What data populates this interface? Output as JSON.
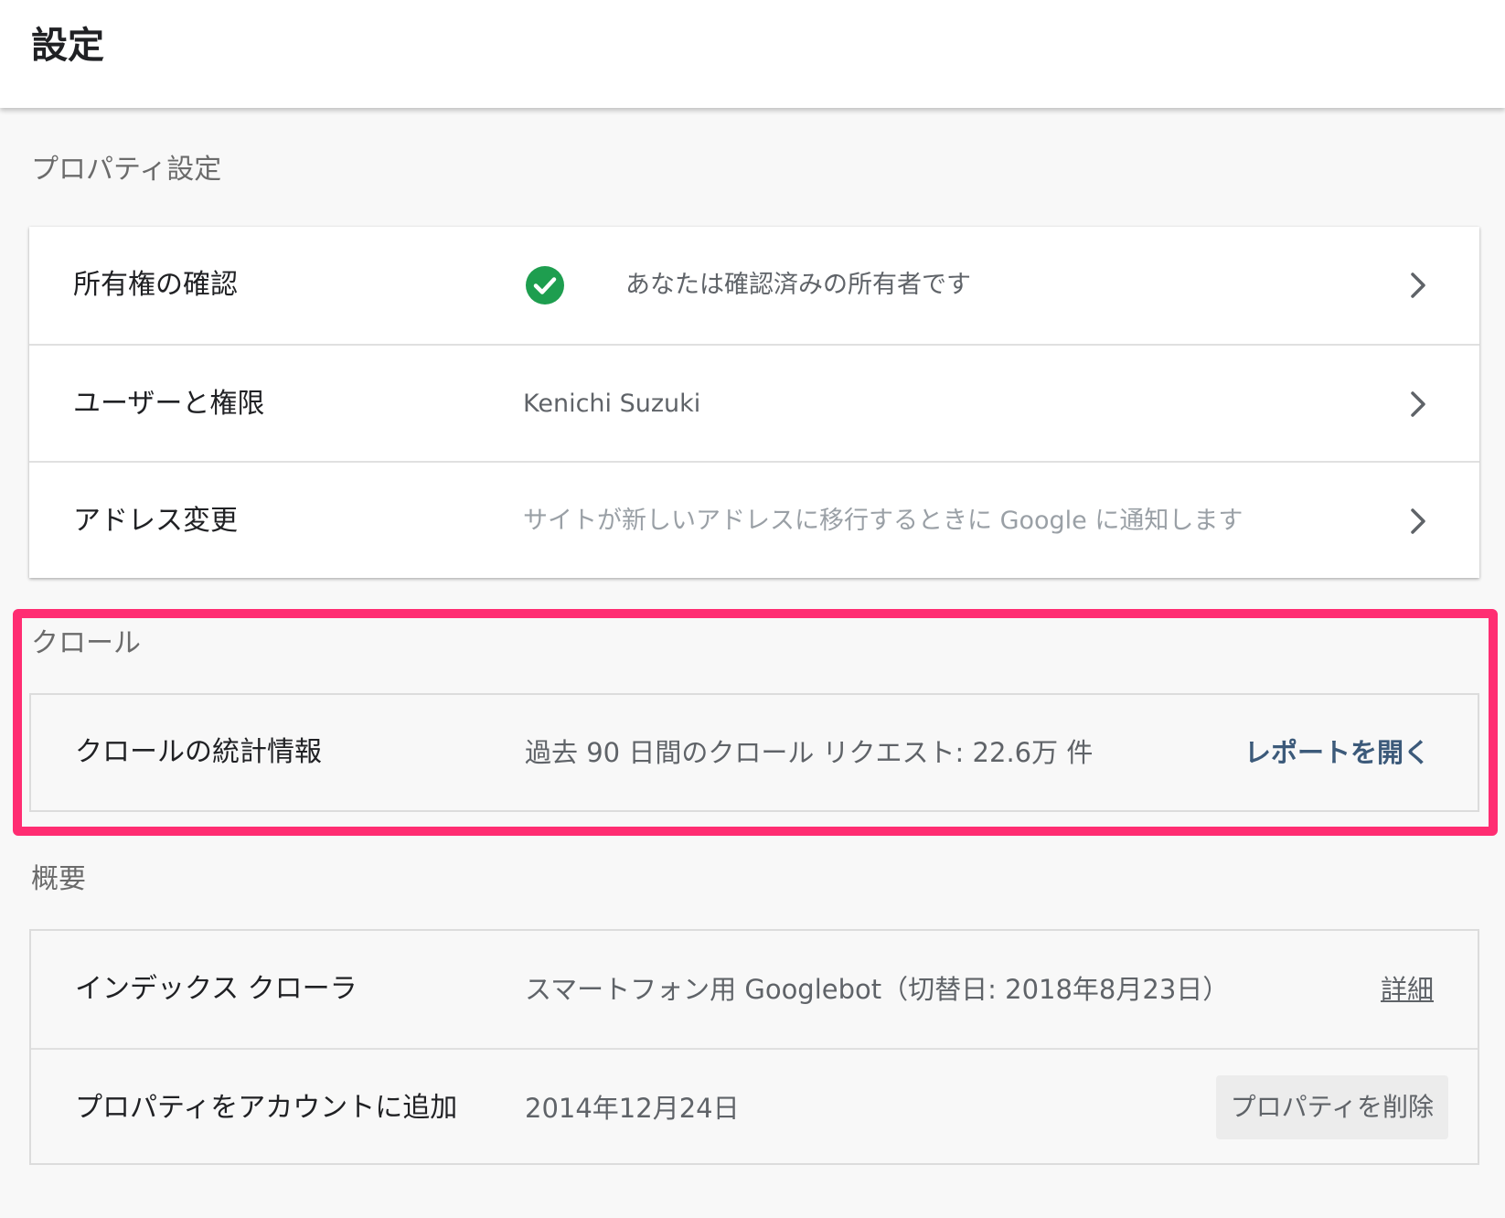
{
  "header": {
    "title": "設定"
  },
  "sections": {
    "property_settings": {
      "label": "プロパティ設定",
      "rows": {
        "ownership": {
          "label": "所有権の確認",
          "value": "あなたは確認済みの所有者です"
        },
        "users": {
          "label": "ユーザーと権限",
          "value": "Kenichi Suzuki"
        },
        "change_address": {
          "label": "アドレス変更",
          "value": "サイトが新しいアドレスに移行するときに Google に通知します"
        }
      }
    },
    "crawl": {
      "label": "クロール",
      "rows": {
        "crawl_stats": {
          "label": "クロールの統計情報",
          "value": "過去 90 日間のクロール リクエスト: 22.6万 件",
          "action": "レポートを開く"
        }
      }
    },
    "overview": {
      "label": "概要",
      "rows": {
        "index_crawler": {
          "label": "インデックス クローラ",
          "value": "スマートフォン用 Googlebot（切替日: 2018年8月23日）",
          "action": "詳細"
        },
        "added": {
          "label": "プロパティをアカウントに追加",
          "value": "2014年12月24日",
          "action": "プロパティを削除"
        }
      }
    }
  },
  "colors": {
    "check": "#1e9e4f",
    "highlight": "#ff2d72",
    "link": "#3c5a7a"
  }
}
